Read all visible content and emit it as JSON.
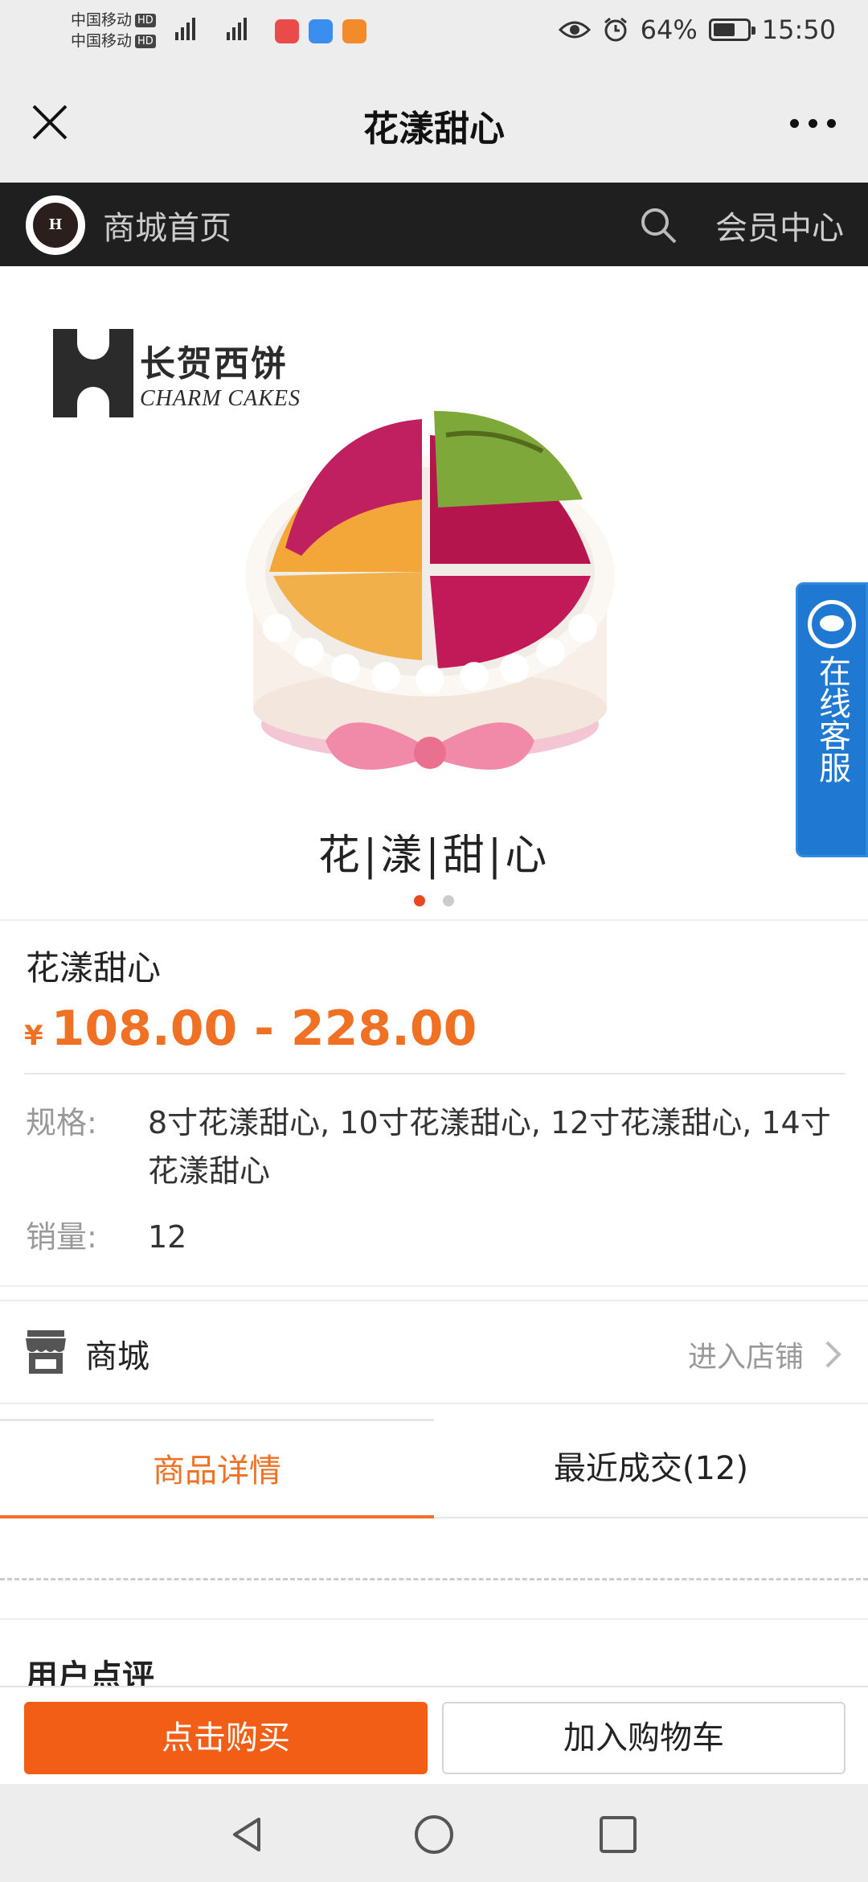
{
  "status_bar": {
    "carrier1": "中国移动",
    "carrier2": "中国移动",
    "hd_badge": "HD",
    "network": "4G",
    "battery_percent": "64%",
    "battery_level": 0.64,
    "time": "15:50"
  },
  "titlebar": {
    "title": "花漾甜心",
    "close_icon": "close-icon",
    "more_icon": "more-icon"
  },
  "shop_nav": {
    "logo_text": "H",
    "home_label": "商城首页",
    "member_label": "会员中心"
  },
  "banner": {
    "brand_cn": "长贺西饼",
    "brand_en": "CHARM CAKES",
    "caption": "花|漾|甜|心",
    "slide_count": 2,
    "active_slide": 1
  },
  "service_tab": {
    "label": "在线客服"
  },
  "product": {
    "name": "花漾甜心",
    "currency": "¥",
    "price_range": "108.00 - 228.00",
    "spec_label": "规格:",
    "spec_value": "8寸花漾甜心, 10寸花漾甜心, 12寸花漾甜心, 14寸花漾甜心",
    "sales_label": "销量:",
    "sales_value": "12"
  },
  "shop_row": {
    "name": "商城",
    "enter_label": "进入店铺"
  },
  "tabs": [
    {
      "label": "商品详情",
      "active": true
    },
    {
      "label": "最近成交(12)",
      "active": false
    }
  ],
  "reviews": {
    "heading": "用户点评"
  },
  "actions": {
    "buy_label": "点击购买",
    "cart_label": "加入购物车"
  },
  "colors": {
    "accent": "#f07024",
    "buy_button": "#f25e16",
    "service_blue": "#1f78d1",
    "nav_dark": "#1f1f1f"
  }
}
